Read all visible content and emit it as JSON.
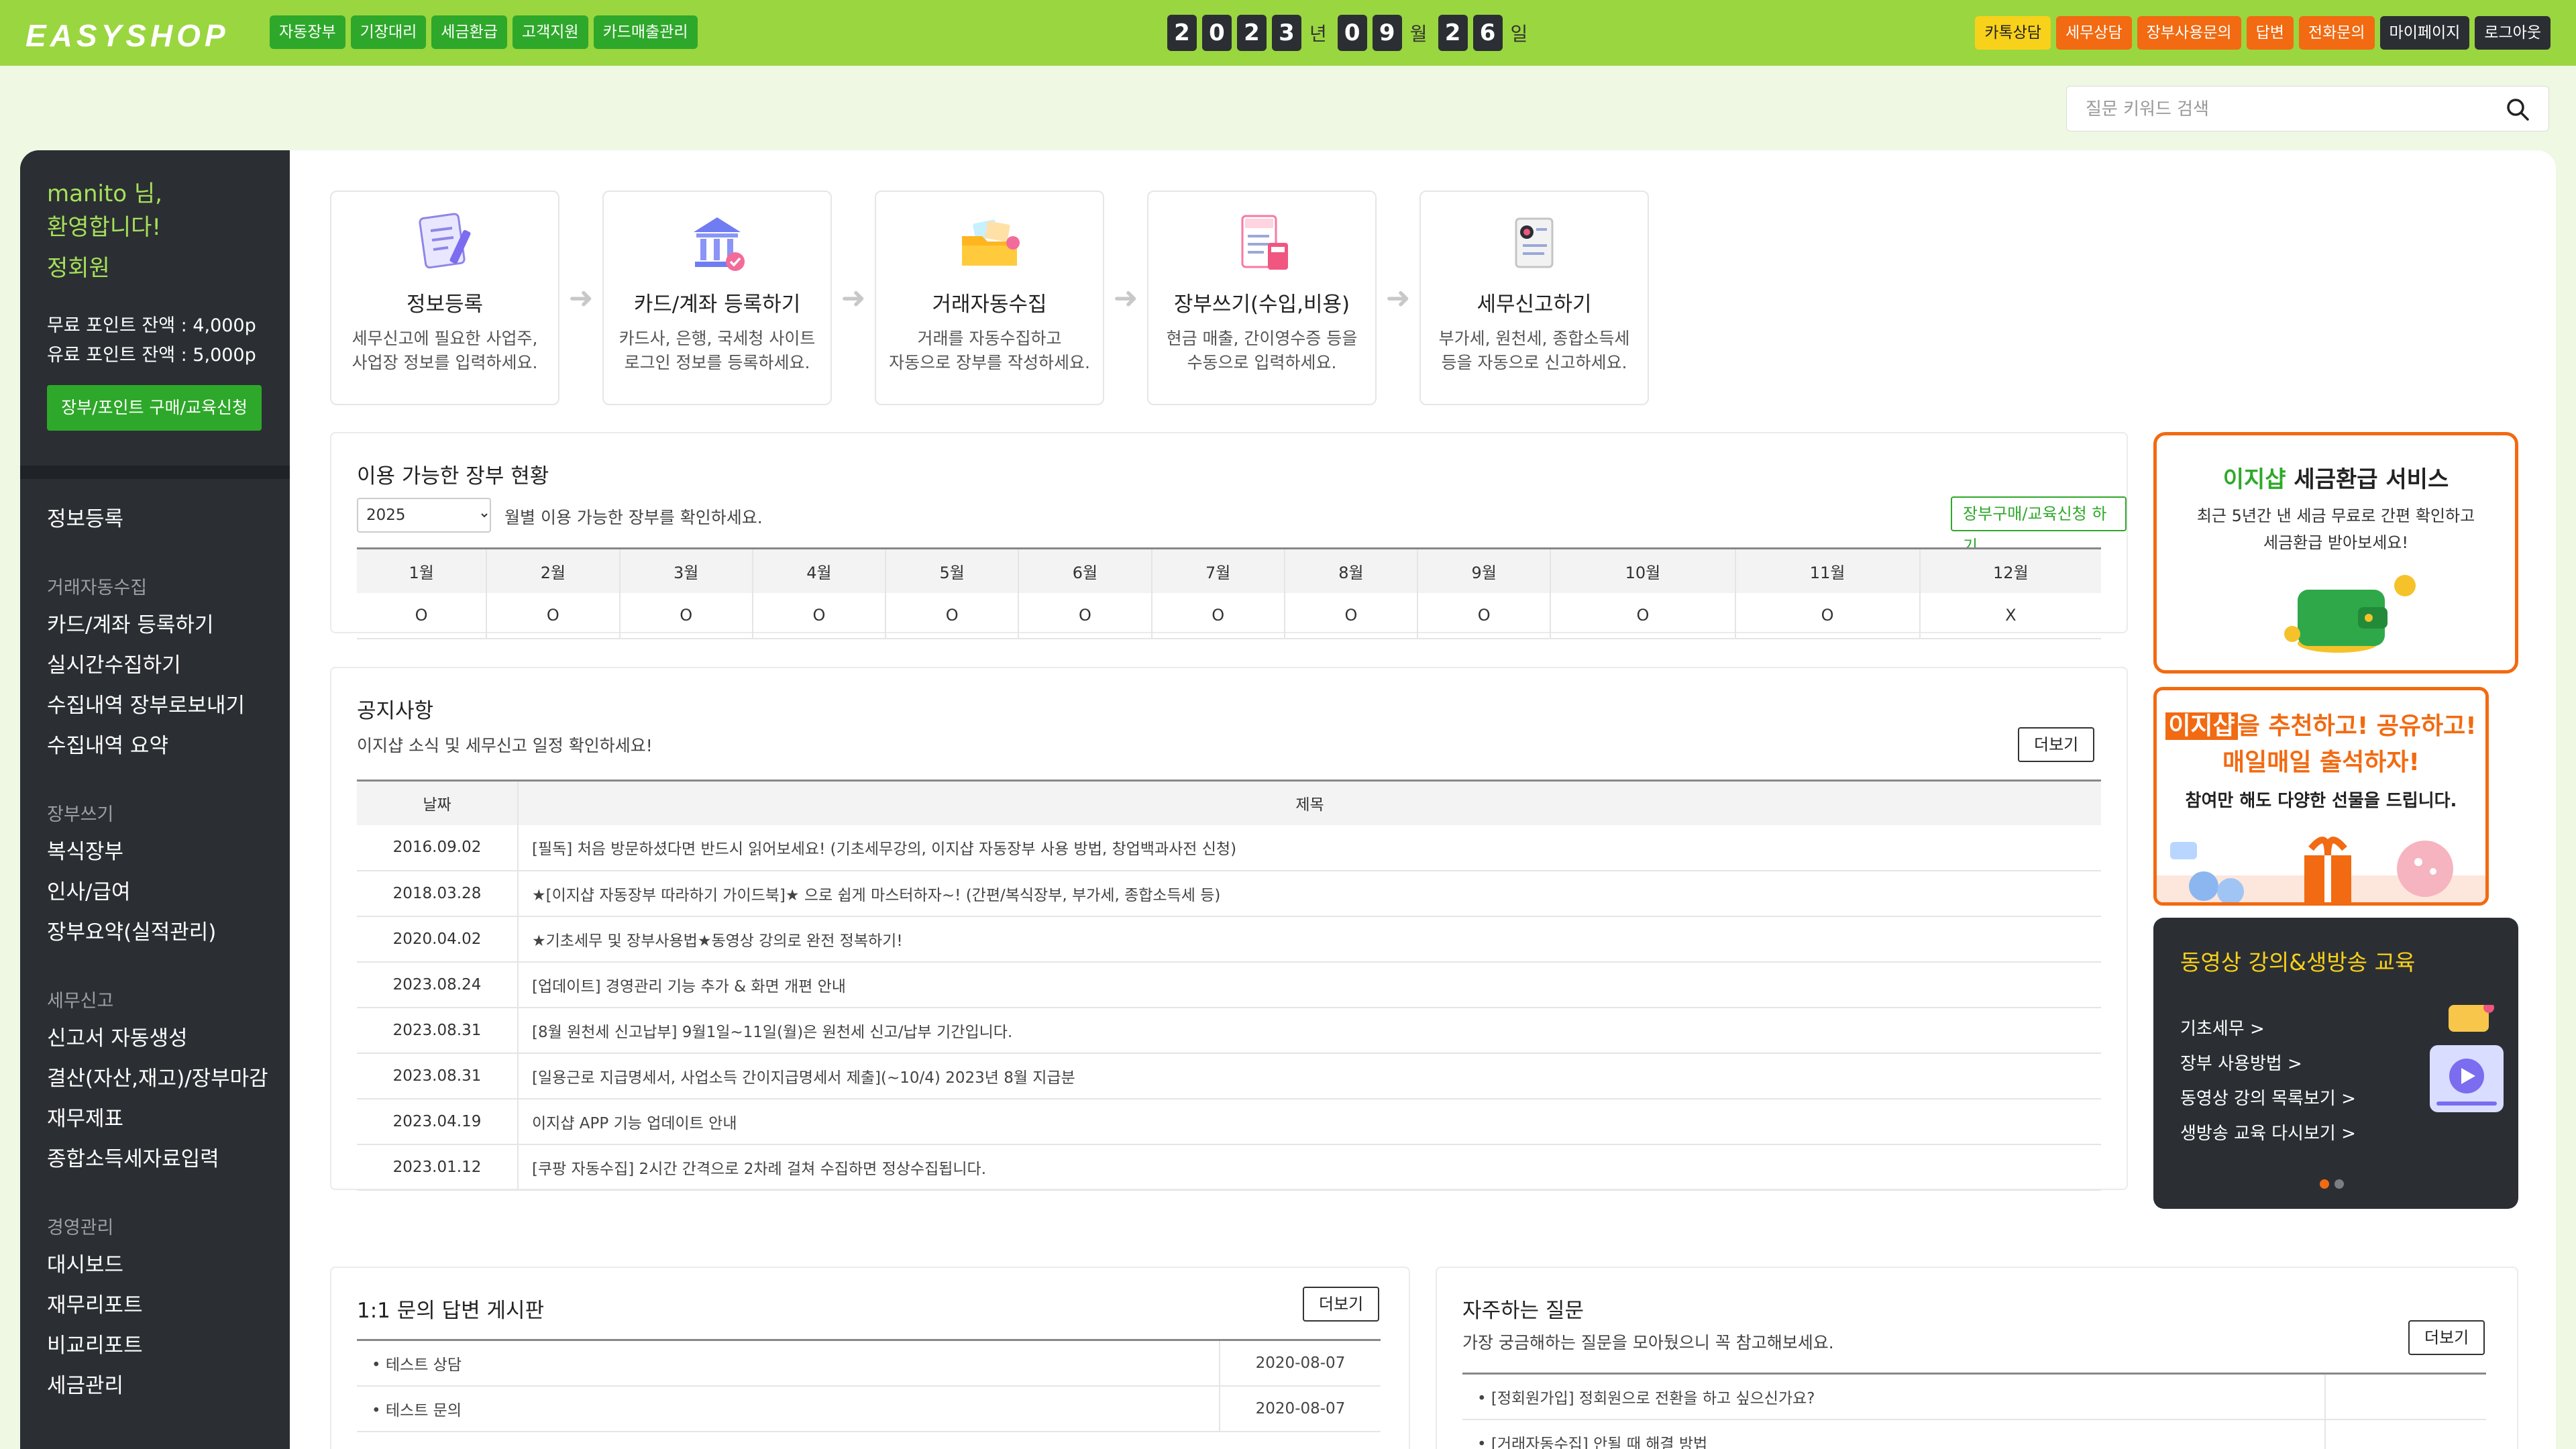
{
  "header": {
    "logo": "EASYSHOP",
    "nav": [
      "자동장부",
      "기장대리",
      "세금환급",
      "고객지원",
      "카드매출관리"
    ],
    "date": {
      "year": [
        "2",
        "0",
        "2",
        "3"
      ],
      "month": [
        "0",
        "9"
      ],
      "day": [
        "2",
        "6"
      ],
      "year_unit": "년",
      "month_unit": "월",
      "day_unit": "일"
    },
    "links": [
      {
        "label": "카톡상담",
        "style": "yellow"
      },
      {
        "label": "세무상담",
        "style": "orange"
      },
      {
        "label": "장부사용문의",
        "style": "orange"
      },
      {
        "label": "답변",
        "style": "orange"
      },
      {
        "label": "전화문의",
        "style": "orange"
      },
      {
        "label": "마이페이지",
        "style": "dark"
      },
      {
        "label": "로그아웃",
        "style": "dark"
      }
    ]
  },
  "search": {
    "placeholder": "질문 키워드 검색"
  },
  "sidebar": {
    "welcome_line1": "manito 님,",
    "welcome_line2": "환영합니다!",
    "grade": "정회원",
    "free_points": "무료 포인트 잔액 : 4,000p",
    "paid_points": "유료 포인트 잔액 : 5,000p",
    "buy_button": "장부/포인트 구매/교육신청",
    "top_item": "정보등록",
    "groups": [
      {
        "heading": "거래자동수집",
        "items": [
          "카드/계좌 등록하기",
          "실시간수집하기",
          "수집내역 장부로보내기",
          "수집내역 요약"
        ]
      },
      {
        "heading": "장부쓰기",
        "items": [
          "복식장부",
          "인사/급여",
          "장부요약(실적관리)"
        ]
      },
      {
        "heading": "세무신고",
        "items": [
          "신고서 자동생성",
          "결산(자산,재고)/장부마감",
          "재무제표",
          "종합소득세자료입력"
        ]
      },
      {
        "heading": "경영관리",
        "items": [
          "대시보드",
          "재무리포트",
          "비교리포트",
          "세금관리"
        ]
      }
    ]
  },
  "steps": [
    {
      "title": "정보등록",
      "desc1": "세무신고에 필요한 사업주,",
      "desc2": "사업장 정보를 입력하세요.",
      "icon": "document-icon"
    },
    {
      "title": "카드/계좌 등록하기",
      "desc1": "카드사, 은행, 국세청 사이트",
      "desc2": "로그인 정보를 등록하세요.",
      "icon": "bank-icon"
    },
    {
      "title": "거래자동수집",
      "desc1": "거래를 자동수집하고",
      "desc2": "자동으로 장부를 작성하세요.",
      "icon": "folder-icon"
    },
    {
      "title": "장부쓰기(수입,비용)",
      "desc1": "현금 매출, 간이영수증 등을",
      "desc2": "수동으로 입력하세요.",
      "icon": "receipt-icon"
    },
    {
      "title": "세무신고하기",
      "desc1": "부가세, 원천세, 종합소득세",
      "desc2": "등을 자동으로 신고하세요.",
      "icon": "report-icon"
    }
  ],
  "ledger": {
    "title": "이용 가능한 장부 현황",
    "year": "2025",
    "subtitle": "월별 이용 가능한 장부를 확인하세요.",
    "button": "장부구매/교육신청 하기",
    "months": [
      "1월",
      "2월",
      "3월",
      "4월",
      "5월",
      "6월",
      "7월",
      "8월",
      "9월",
      "10월",
      "11월",
      "12월"
    ],
    "status": [
      "O",
      "O",
      "O",
      "O",
      "O",
      "O",
      "O",
      "O",
      "O",
      "O",
      "O",
      "X"
    ]
  },
  "notice": {
    "title": "공지사항",
    "subtitle": "이지샵 소식 및 세무신고 일정 확인하세요!",
    "more": "더보기",
    "col_date": "날짜",
    "col_title": "제목",
    "rows": [
      {
        "date": "2016.09.02",
        "title": "[필독] 처음 방문하셨다면 반드시 읽어보세요! (기초세무강의, 이지샵 자동장부 사용 방법, 창업백과사전 신청)"
      },
      {
        "date": "2018.03.28",
        "title": "★[이지샵 자동장부 따라하기 가이드북]★ 으로 쉽게 마스터하자~! (간편/복식장부, 부가세, 종합소득세 등)"
      },
      {
        "date": "2020.04.02",
        "title": "★기초세무 및 장부사용법★동영상 강의로 완전 정복하기!"
      },
      {
        "date": "2023.08.24",
        "title": "[업데이트] 경영관리 기능 추가 & 화면 개편 안내"
      },
      {
        "date": "2023.08.31",
        "title": "[8월 원천세 신고납부] 9월1일~11일(월)은 원천세 신고/납부 기간입니다."
      },
      {
        "date": "2023.08.31",
        "title": "[일용근로 지급명세서, 사업소득 간이지급명세서 제출](~10/4) 2023년 8월 지급분"
      },
      {
        "date": "2023.04.19",
        "title": "이지샵 APP 기능 업데이트 안내"
      },
      {
        "date": "2023.01.12",
        "title": "[쿠팡 자동수집] 2시간 간격으로 2차례 걸쳐 수집하면 정상수집됩니다."
      }
    ]
  },
  "qna": {
    "title": "1:1 문의 답변 게시판",
    "more": "더보기",
    "rows": [
      {
        "title": "• 테스트 상담",
        "date": "2020-08-07"
      },
      {
        "title": "• 테스트 문의",
        "date": "2020-08-07"
      }
    ]
  },
  "faq": {
    "title": "자주하는 질문",
    "subtitle": "가장 궁금해하는 질문을 모아뒀으니 꼭 참고해보세요.",
    "more": "더보기",
    "rows": [
      "• [정회원가입] 정회원으로 전환을 하고 싶으신가요?",
      "• [거래자동수집] 안될 때 해결 방법"
    ]
  },
  "banners": {
    "refund_brand": "이지샵",
    "refund_title": " 세금환급 서비스",
    "refund_desc1": "최근 5년간 낸 세금 무료로 간편 확인하고",
    "refund_desc2": "세금환급 받아보세요!",
    "recommend_brand": "이지샵",
    "recommend_line1": "을 추천하고! 공유하고!",
    "recommend_line2": "매일매일 출석하자!",
    "recommend_line3": "참여만 해도 다양한 선물을 드립니다.",
    "video_title": "동영상 강의&생방송 교육",
    "video_links": [
      "기초세무 >",
      "장부 사용방법 >",
      "동영상 강의 목록보기 >",
      "생방송 교육 다시보기 >"
    ],
    "accent_green": "#9ad63f",
    "accent_orange": "#f26a11"
  }
}
